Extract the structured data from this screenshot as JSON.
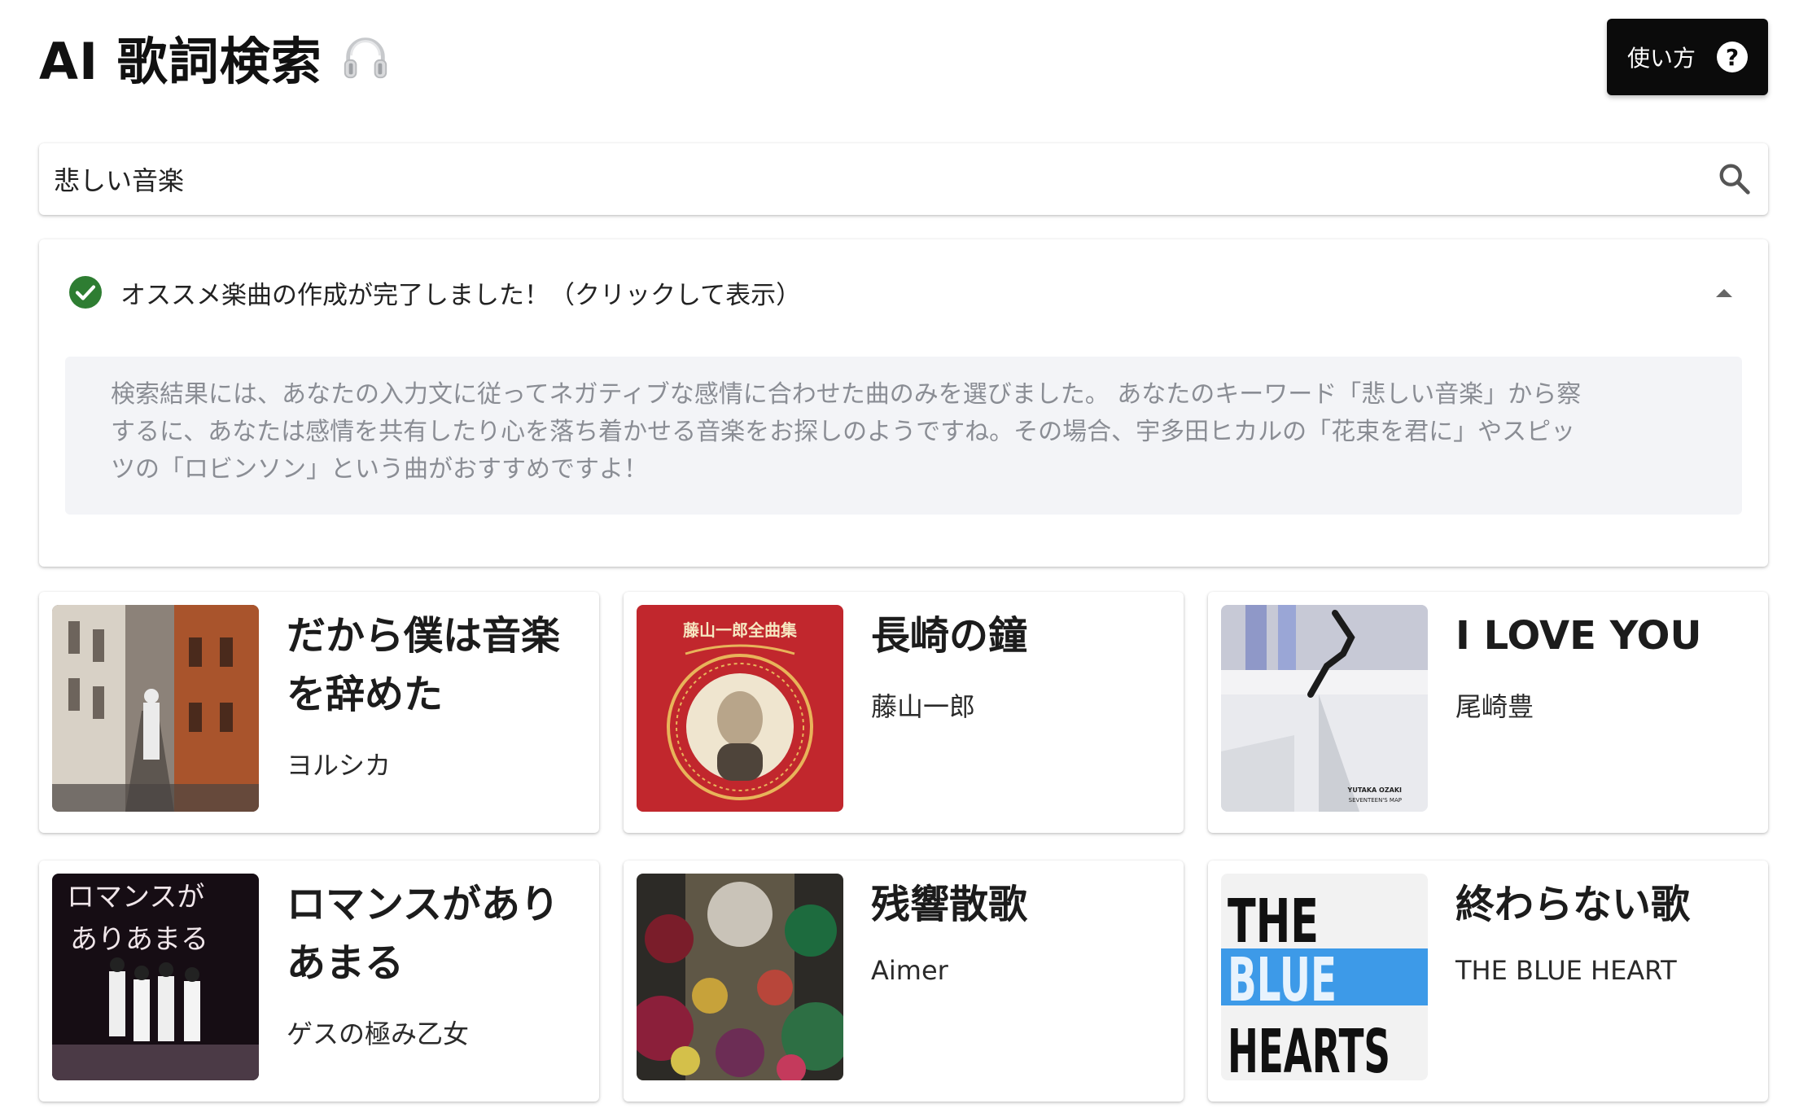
{
  "header": {
    "title": "AI 歌詞検索",
    "help_label": "使い方",
    "help_icon": "?"
  },
  "search": {
    "value": "悲しい音楽"
  },
  "result": {
    "status": "オススメ楽曲の作成が完了しました！（クリックして表示）",
    "expanded": true,
    "message_lines": [
      "検索結果には、あなたの入力文に従ってネガティブな感情に合わせた曲のみを選びました。 あなたのキーワード「悲しい音楽」から察",
      "するに、あなたは感情を共有したり心を落ち着かせる音楽をお探しのようですね。その場合、宇多田ヒカルの「花束を君に」やスピッ",
      "ツの「ロビンソン」という曲がおすすめですよ！"
    ]
  },
  "songs": [
    {
      "title_lines": [
        "だから僕は音楽",
        "を辞めた"
      ],
      "artist": "ヨルシカ"
    },
    {
      "title_lines": [
        "長崎の鐘"
      ],
      "artist": "藤山一郎",
      "cover_text": "藤山一郎全曲集"
    },
    {
      "title_lines": [
        "I LOVE YOU"
      ],
      "artist": "尾崎豊",
      "cover_text_1": "YUTAKA OZAKI",
      "cover_text_2": "SEVENTEEN'S MAP"
    },
    {
      "title_lines": [
        "ロマンスがあり",
        "あまる"
      ],
      "artist": "ゲスの極み乙女",
      "cover_text_1": "ロマンスが",
      "cover_text_2": "ありあまる"
    },
    {
      "title_lines": [
        "残響散歌"
      ],
      "artist": "Aimer"
    },
    {
      "title_lines": [
        "終わらない歌"
      ],
      "artist": "THE BLUE HEART",
      "cover_text_1": "THE",
      "cover_text_2": "BLUE",
      "cover_text_3": "HEARTS"
    }
  ]
}
